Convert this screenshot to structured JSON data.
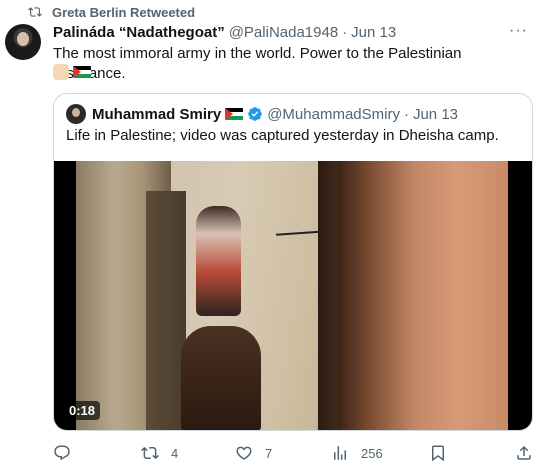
{
  "retweet": {
    "label": "Greta Berlin Retweeted",
    "icon": "retweet-icon"
  },
  "tweet": {
    "display_name": "Palináda “Nadathegoat”",
    "handle": "@PaliNada1948",
    "separator": "·",
    "date": "Jun 13",
    "more_label": "···",
    "text": "The most immoral army in the world. Power to the Palestinian resistance.",
    "emojis": [
      "raised-fist-emoji",
      "palestine-flag-emoji"
    ]
  },
  "quote": {
    "display_name": "Muhammad Smiry",
    "handle": "@MuhammadSmiry",
    "separator": "·",
    "date": "Jun 13",
    "text": "Life in Palestine; video was captured yesterday in Dheisha camp.",
    "video_timecode": "0:18",
    "verified_color": "#1d9bf0"
  },
  "actions": {
    "reply": {
      "icon": "reply-icon",
      "count": ""
    },
    "retweet": {
      "icon": "retweet-icon",
      "count": "4"
    },
    "like": {
      "icon": "heart-icon",
      "count": "7"
    },
    "views": {
      "icon": "views-icon",
      "count": "256"
    },
    "share": {
      "icon": "share-icon",
      "count": ""
    }
  },
  "colors": {
    "text_primary": "#0f1419",
    "text_secondary": "#536471",
    "border": "#cfd9de"
  }
}
